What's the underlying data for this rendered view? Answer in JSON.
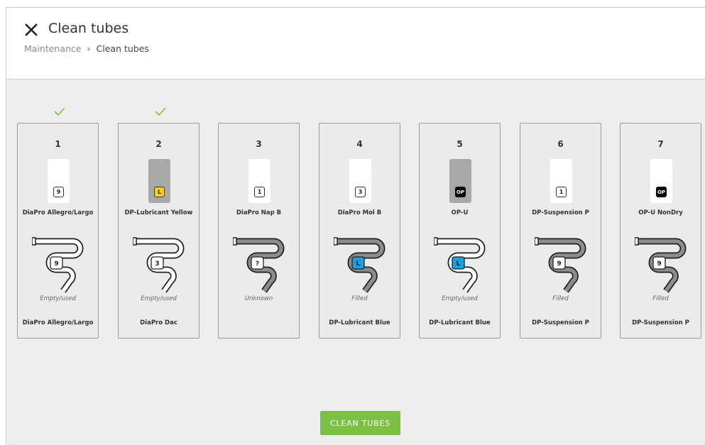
{
  "header": {
    "title": "Clean tubes",
    "breadcrumb": {
      "parent": "Maintenance",
      "separator": "›",
      "current": "Clean tubes"
    }
  },
  "colors": {
    "accent_green": "#7cc043",
    "checkmark": "#7cc043",
    "lubricant_yellow": "#f5cf1a",
    "lubricant_blue": "#1ba0e1",
    "tube_white": "#ffffff",
    "tube_grey": "#8c8c8c"
  },
  "stations": [
    {
      "number": "1",
      "checked": true,
      "bottle": "white",
      "bottle_badge": "9",
      "bottle_badge_style": "std",
      "bottle_name": "DiaPro Allegro/Largo",
      "tube_fill": "white",
      "tube_badge": "9",
      "tube_badge_style": "std",
      "state": "Empty/used",
      "tube_name": "DiaPro Allegro/Largo"
    },
    {
      "number": "2",
      "checked": true,
      "bottle": "grey",
      "bottle_badge": "L",
      "bottle_badge_style": "yellow",
      "bottle_name": "DP-Lubricant Yellow",
      "tube_fill": "white",
      "tube_badge": "3",
      "tube_badge_style": "std",
      "state": "Empty/used",
      "tube_name": "DiaPro Dac"
    },
    {
      "number": "3",
      "checked": false,
      "bottle": "white",
      "bottle_badge": "1",
      "bottle_badge_style": "std",
      "bottle_name": "DiaPro Nap B",
      "tube_fill": "grey",
      "tube_badge": "?",
      "tube_badge_style": "std",
      "state": "Unknown",
      "tube_name": ""
    },
    {
      "number": "4",
      "checked": false,
      "bottle": "white",
      "bottle_badge": "3",
      "bottle_badge_style": "std",
      "bottle_name": "DiaPro Mol B",
      "tube_fill": "grey",
      "tube_badge": "L",
      "tube_badge_style": "blue",
      "state": "Filled",
      "tube_name": "DP-Lubricant Blue"
    },
    {
      "number": "5",
      "checked": false,
      "bottle": "grey",
      "bottle_badge": "OP",
      "bottle_badge_style": "op",
      "bottle_name": "OP-U",
      "tube_fill": "white",
      "tube_badge": "L",
      "tube_badge_style": "blue",
      "state": "Empty/used",
      "tube_name": "DP-Lubricant Blue"
    },
    {
      "number": "6",
      "checked": false,
      "bottle": "white",
      "bottle_badge": "1",
      "bottle_badge_style": "std",
      "bottle_name": "DP-Suspension P",
      "tube_fill": "grey",
      "tube_badge": "9",
      "tube_badge_style": "std",
      "state": "Filled",
      "tube_name": "DP-Suspension P"
    },
    {
      "number": "7",
      "checked": false,
      "bottle": "white",
      "bottle_badge": "OP",
      "bottle_badge_style": "op",
      "bottle_name": "OP-U NonDry",
      "tube_fill": "grey",
      "tube_badge": "9",
      "tube_badge_style": "std",
      "state": "Filled",
      "tube_name": "DP-Suspension P"
    }
  ],
  "actions": {
    "clean_label": "CLEAN TUBES"
  }
}
